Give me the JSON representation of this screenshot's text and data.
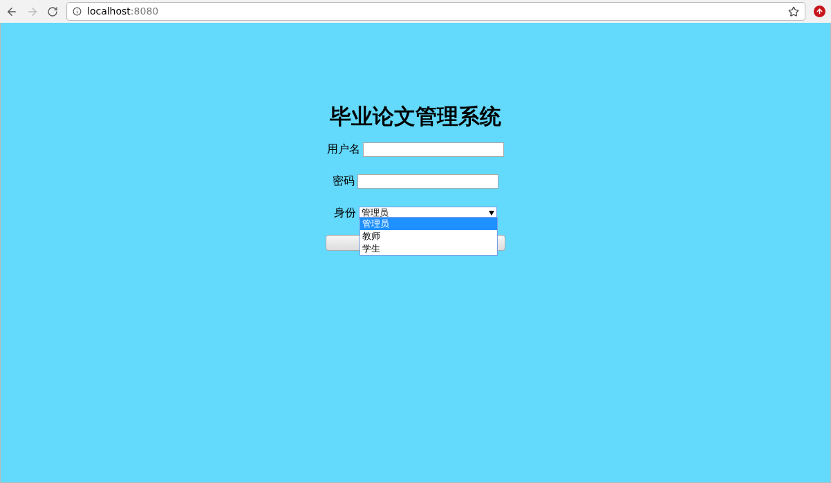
{
  "browser": {
    "url_host": "localhost",
    "url_port": ":8080"
  },
  "title": "毕业论文管理系统",
  "fields": [
    {
      "label": "用户名"
    },
    {
      "label": "密码"
    }
  ],
  "role": {
    "label": "身份",
    "value": "管理员",
    "expanded": true,
    "options": [
      {
        "label": "管理员",
        "selected": true
      },
      {
        "label": "教师",
        "selected": false
      },
      {
        "label": "学生",
        "selected": false
      }
    ]
  }
}
